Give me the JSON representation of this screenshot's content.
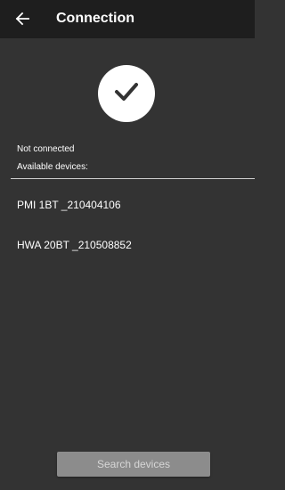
{
  "appbar": {
    "title": "Connection",
    "back_icon": "arrow-left-icon",
    "background": "#1e1e1e"
  },
  "status": {
    "icon": "checkmark-icon",
    "text": "Not connected"
  },
  "devices": {
    "label": "Available devices:",
    "items": [
      {
        "name": "PMI 1BT _210404106"
      },
      {
        "name": "HWA 20BT _210508852"
      }
    ]
  },
  "actions": {
    "search_label": "Search devices",
    "search_color": "#8c8c8c"
  },
  "colors": {
    "background": "#333333",
    "text": "#ffffff"
  }
}
